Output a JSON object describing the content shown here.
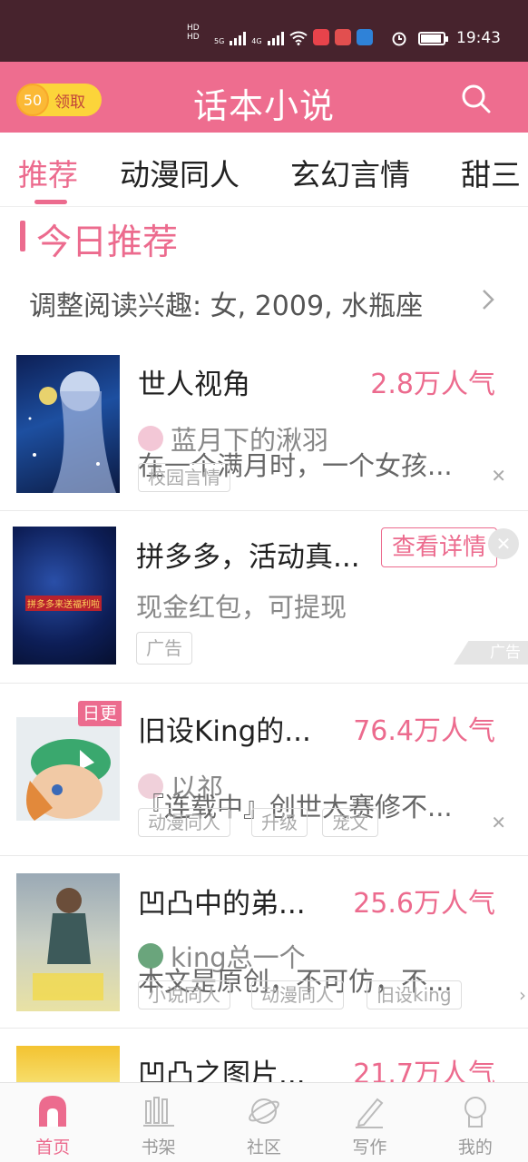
{
  "status": {
    "signal_text": "HD₁\nHD₂",
    "net1": "5G",
    "net2": "4G",
    "time": "19:43",
    "battery_level": 0.9
  },
  "topbar": {
    "coin_amount": "50",
    "coin_label": "领取",
    "title": "话本小说"
  },
  "tabs": [
    "推荐",
    "动漫同人",
    "玄幻言情",
    "甜三"
  ],
  "section": {
    "title": "今日推荐",
    "interest": "调整阅读兴趣: 女, 2009, 水瓶座"
  },
  "books": [
    {
      "title": "世人视角",
      "popularity": "2.8万人气",
      "author": "蓝月下的湫羽",
      "desc": "在一个满月时，一个女孩...",
      "tags": [
        "校园言情"
      ]
    },
    {
      "title": "拼多多，活动真...",
      "desc": "现金红包，可提现",
      "tags": [
        "广告"
      ],
      "ad_button": "查看详情",
      "ad_mark": "广告",
      "cover_text": "拼多多来送福利啦"
    },
    {
      "title": "旧设King的...",
      "popularity": "76.4万人气",
      "author": "以祁",
      "desc": "『连载中』创世大赛修不...",
      "tags": [
        "动漫同人",
        "升级",
        "宠文"
      ],
      "badge": "日更"
    },
    {
      "title": "凹凸中的弟...",
      "popularity": "25.6万人气",
      "author": "king总一个",
      "desc": "本文是原创，不可仿，不...",
      "tags": [
        "小说同人",
        "动漫同人",
        "旧设king"
      ]
    },
    {
      "title": "凹凸之图片...",
      "popularity": "21.7万人气"
    }
  ],
  "nav": [
    "首页",
    "书架",
    "社区",
    "写作",
    "我的"
  ],
  "colors": {
    "accent": "#ec6b8e",
    "statusbar": "#47232d",
    "topbar": "#ee6d8f"
  }
}
